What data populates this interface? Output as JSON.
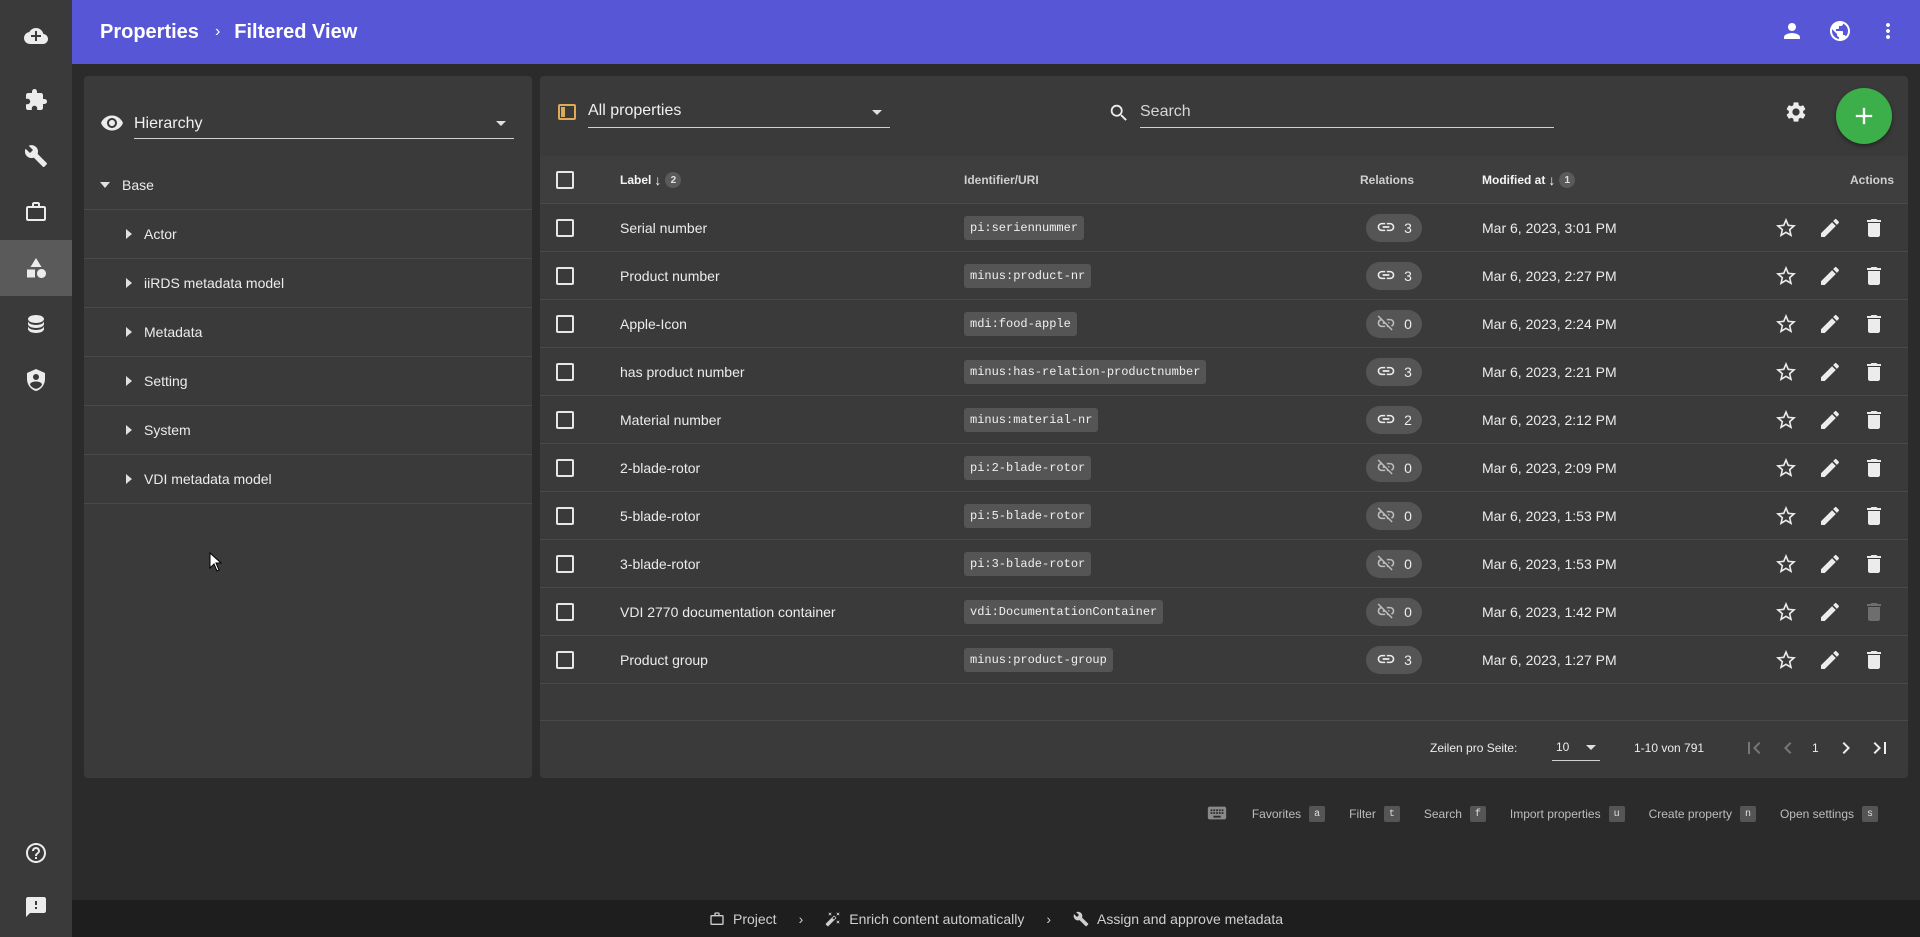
{
  "header": {
    "breadcrumb": [
      "Properties",
      "Filtered View"
    ],
    "separator": "›",
    "icons": [
      "account-icon",
      "globe-icon",
      "more-vert-icon"
    ]
  },
  "rail": {
    "items": [
      {
        "icon": "cloud-add-icon"
      },
      {
        "icon": "puzzle-icon"
      },
      {
        "icon": "wrench-icon"
      },
      {
        "icon": "briefcase-icon"
      },
      {
        "icon": "shapes-icon",
        "active": true
      },
      {
        "icon": "database-icon"
      },
      {
        "icon": "shield-account-icon"
      },
      {
        "icon": "help-icon"
      },
      {
        "icon": "feedback-icon"
      }
    ]
  },
  "left_panel": {
    "view_select": "Hierarchy",
    "tree": [
      {
        "label": "Base",
        "level": 0,
        "expanded": true
      },
      {
        "label": "Actor",
        "level": 1
      },
      {
        "label": "iiRDS metadata model",
        "level": 1
      },
      {
        "label": "Metadata",
        "level": 1
      },
      {
        "label": "Setting",
        "level": 1
      },
      {
        "label": "System",
        "level": 1
      },
      {
        "label": "VDI metadata model",
        "level": 1
      }
    ]
  },
  "toolbar": {
    "filter_select": "All properties",
    "search_placeholder": "Search"
  },
  "table": {
    "headers": {
      "label": "Label",
      "label_sort_order": "2",
      "identifier": "Identifier/URI",
      "relations": "Relations",
      "modified": "Modified at",
      "modified_sort_order": "1",
      "actions": "Actions"
    },
    "sort_arrow": "↓",
    "rows": [
      {
        "label": "Serial number",
        "identifier": "pi:seriennummer",
        "relations": "3",
        "linked": true,
        "modified": "Mar 6, 2023, 3:01 PM",
        "delete_disabled": false
      },
      {
        "label": "Product number",
        "identifier": "minus:product-nr",
        "relations": "3",
        "linked": true,
        "modified": "Mar 6, 2023, 2:27 PM",
        "delete_disabled": false
      },
      {
        "label": "Apple-Icon",
        "identifier": "mdi:food-apple",
        "relations": "0",
        "linked": false,
        "modified": "Mar 6, 2023, 2:24 PM",
        "delete_disabled": false
      },
      {
        "label": "has product number",
        "identifier": "minus:has-relation-productnumber",
        "relations": "3",
        "linked": true,
        "modified": "Mar 6, 2023, 2:21 PM",
        "delete_disabled": false
      },
      {
        "label": "Material number",
        "identifier": "minus:material-nr",
        "relations": "2",
        "linked": true,
        "modified": "Mar 6, 2023, 2:12 PM",
        "delete_disabled": false
      },
      {
        "label": "2-blade-rotor",
        "identifier": "pi:2-blade-rotor",
        "relations": "0",
        "linked": false,
        "modified": "Mar 6, 2023, 2:09 PM",
        "delete_disabled": false
      },
      {
        "label": "5-blade-rotor",
        "identifier": "pi:5-blade-rotor",
        "relations": "0",
        "linked": false,
        "modified": "Mar 6, 2023, 1:53 PM",
        "delete_disabled": false
      },
      {
        "label": "3-blade-rotor",
        "identifier": "pi:3-blade-rotor",
        "relations": "0",
        "linked": false,
        "modified": "Mar 6, 2023, 1:53 PM",
        "delete_disabled": false
      },
      {
        "label": "VDI 2770 documentation container",
        "identifier": "vdi:DocumentationContainer",
        "relations": "0",
        "linked": false,
        "modified": "Mar 6, 2023, 1:42 PM",
        "delete_disabled": true
      },
      {
        "label": "Product group",
        "identifier": "minus:product-group",
        "relations": "3",
        "linked": true,
        "modified": "Mar 6, 2023, 1:27 PM",
        "delete_disabled": false
      }
    ]
  },
  "pagination": {
    "rows_label": "Zeilen pro Seite:",
    "rows_value": "10",
    "range": "1-10 von 791",
    "page": "1"
  },
  "shortcuts": [
    {
      "label": "Favorites",
      "key": "a"
    },
    {
      "label": "Filter",
      "key": "t"
    },
    {
      "label": "Search",
      "key": "f"
    },
    {
      "label": "Import properties",
      "key": "u"
    },
    {
      "label": "Create property",
      "key": "n"
    },
    {
      "label": "Open settings",
      "key": "s"
    }
  ],
  "workflow": {
    "steps": [
      "Project",
      "Enrich content automatically",
      "Assign and approve metadata"
    ],
    "separator": "›"
  },
  "colors": {
    "topbar": "#5656d6",
    "fab": "#3cae4a",
    "filter_icon": "#e0a955",
    "background": "#2b2b2b",
    "panel": "#3a3a3a"
  }
}
